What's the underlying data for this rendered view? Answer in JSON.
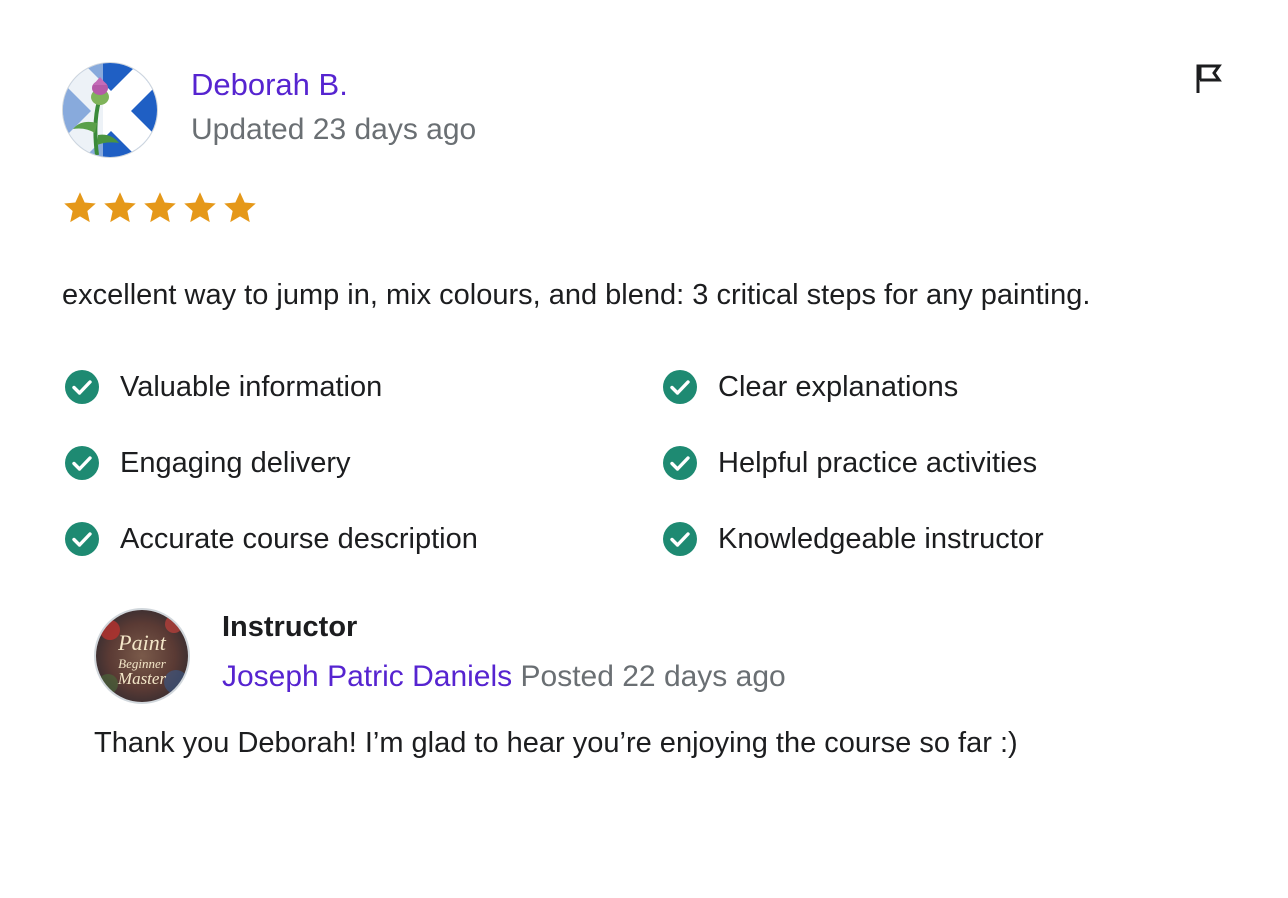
{
  "reviewer": {
    "name": "Deborah B.",
    "date": "Updated 23 days ago",
    "avatar_icon": "thistle-flag-avatar"
  },
  "rating": {
    "stars": 5,
    "max": 5,
    "color": "#e59819"
  },
  "review": {
    "text": "excellent way to jump in, mix colours, and blend: 3 critical steps for any painting."
  },
  "feedback": {
    "check_color": "#1e8a72",
    "items": [
      {
        "label": "Valuable information"
      },
      {
        "label": "Clear explanations"
      },
      {
        "label": "Engaging delivery"
      },
      {
        "label": "Helpful practice activities"
      },
      {
        "label": "Accurate course description"
      },
      {
        "label": "Knowledgeable instructor"
      }
    ]
  },
  "response": {
    "role": "Instructor",
    "name": "Joseph Patric Daniels",
    "posted": "Posted 22 days ago",
    "text": "Thank you Deborah! I’m glad to hear you’re enjoying the course so far :)",
    "avatar_text": [
      "Paint",
      "Beginner",
      "Master"
    ]
  },
  "actions": {
    "report_icon": "flag-icon"
  },
  "colors": {
    "link": "#5624d0",
    "muted": "#6a6f73",
    "text": "#1c1d1f"
  }
}
